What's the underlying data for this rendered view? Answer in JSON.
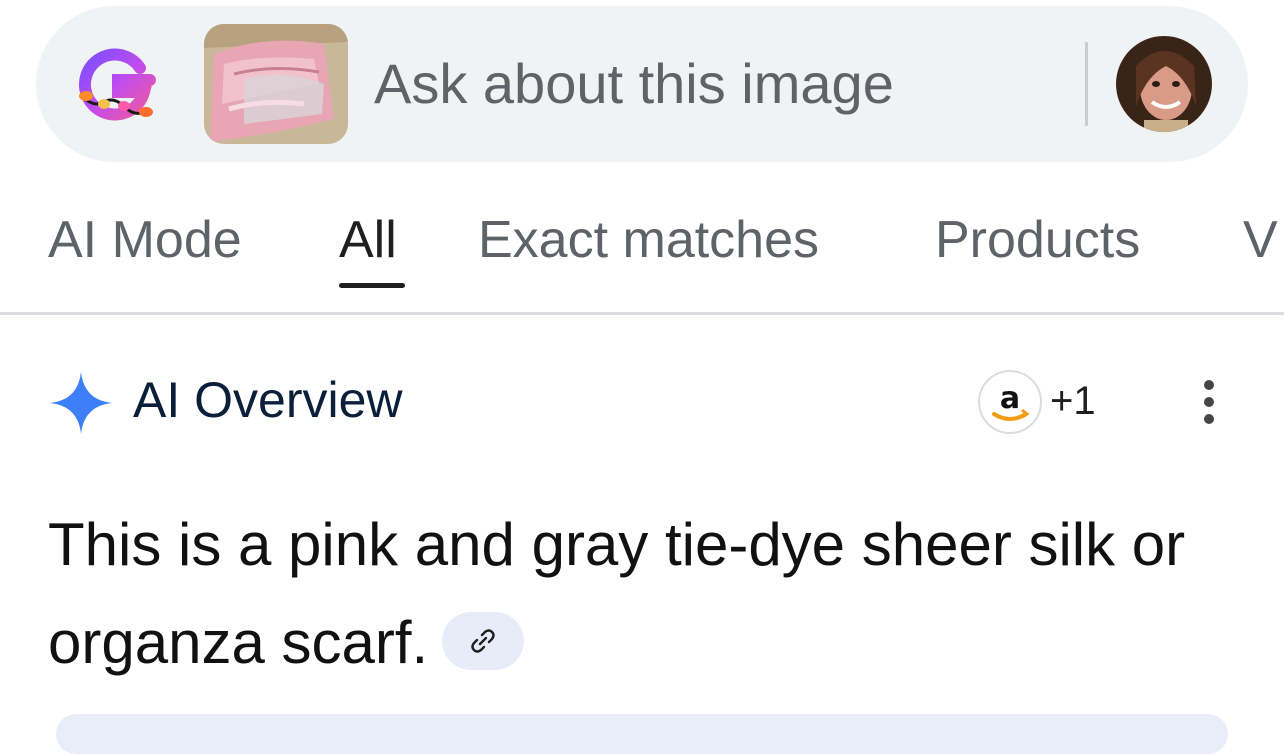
{
  "search": {
    "placeholder": "Ask about this image"
  },
  "tabs": [
    {
      "label": "AI Mode",
      "active": false
    },
    {
      "label": "All",
      "active": true
    },
    {
      "label": "Exact matches",
      "active": false
    },
    {
      "label": "Products",
      "active": false
    },
    {
      "label": "V",
      "active": false
    }
  ],
  "overview": {
    "title": "AI Overview",
    "source_count": "+1",
    "source_icon": "amazon-icon",
    "text": "This is a pink and gray tie-dye sheer silk or organza scarf."
  },
  "colors": {
    "search_bg": "#eff3f4",
    "spark_blue": "#3d7ff6",
    "chip_bg": "#e8ecf9",
    "amazon_orange": "#f39c12"
  }
}
